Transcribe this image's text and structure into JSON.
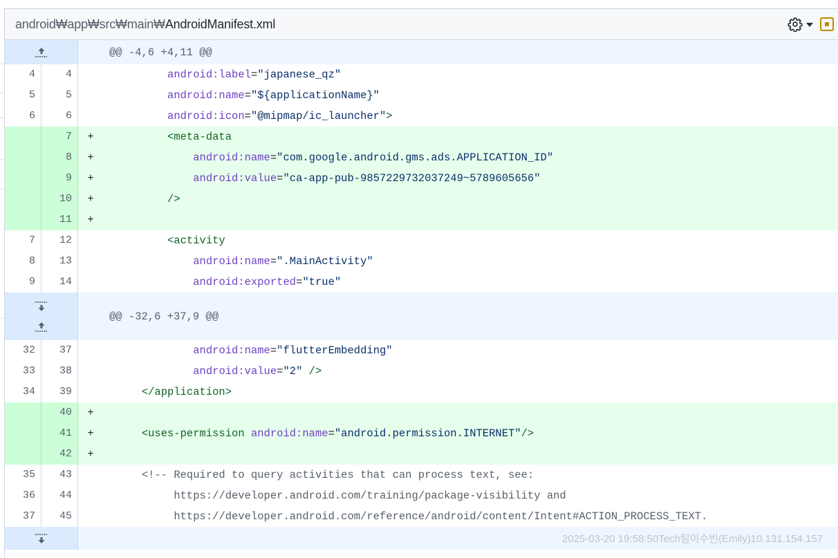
{
  "file": {
    "path_prefix": "android₩app₩src₩main₩",
    "name": "AndroidManifest.xml",
    "icons": {
      "settings": "gear-icon",
      "dropdown": "caret-down-icon",
      "view": "file-view-icon"
    }
  },
  "hunks": [
    {
      "header": "@@ -4,6 +4,11 @@"
    },
    {
      "header": "@@ -32,6 +37,9 @@"
    }
  ],
  "footer": {
    "watermark": "2025-03-20 19:58:50Tech팀이수빈(Emily)10.131.154.157"
  },
  "lines": {
    "l1": {
      "old": "4",
      "new": "4",
      "sign": "",
      "indent": "          ",
      "attr": "android:label",
      "eq": "=",
      "str": "\"japanese_qz\""
    },
    "l2": {
      "old": "5",
      "new": "5",
      "sign": "",
      "indent": "          ",
      "attr": "android:name",
      "eq": "=",
      "str": "\"${applicationName}\""
    },
    "l3": {
      "old": "6",
      "new": "6",
      "sign": "",
      "indent": "          ",
      "attr": "android:icon",
      "eq": "=",
      "str": "\"@mipmap/ic_launcher\"",
      "tag": ">"
    },
    "l4": {
      "old": "",
      "new": "7",
      "sign": "+",
      "indent": "          ",
      "tag": "<meta-data"
    },
    "l5": {
      "old": "",
      "new": "8",
      "sign": "+",
      "indent": "              ",
      "attr": "android:name",
      "eq": "=",
      "str": "\"com.google.android.gms.ads.APPLICATION_ID\""
    },
    "l6": {
      "old": "",
      "new": "9",
      "sign": "+",
      "indent": "              ",
      "attr": "android:value",
      "eq": "=",
      "str": "\"ca-app-pub-9857229732037249~5789605656\""
    },
    "l7": {
      "old": "",
      "new": "10",
      "sign": "+",
      "indent": "          ",
      "tag": "/>"
    },
    "l8": {
      "old": "",
      "new": "11",
      "sign": "+"
    },
    "l9": {
      "old": "7",
      "new": "12",
      "sign": "",
      "indent": "          ",
      "tag": "<activity"
    },
    "l10": {
      "old": "8",
      "new": "13",
      "sign": "",
      "indent": "              ",
      "attr": "android:name",
      "eq": "=",
      "str": "\".MainActivity\""
    },
    "l11": {
      "old": "9",
      "new": "14",
      "sign": "",
      "indent": "              ",
      "attr": "android:exported",
      "eq": "=",
      "str": "\"true\""
    },
    "l12": {
      "old": "32",
      "new": "37",
      "sign": "",
      "indent": "              ",
      "attr": "android:name",
      "eq": "=",
      "str": "\"flutterEmbedding\""
    },
    "l13": {
      "old": "33",
      "new": "38",
      "sign": "",
      "indent": "              ",
      "attr": "android:value",
      "eq": "=",
      "str": "\"2\"",
      "tag": " />"
    },
    "l14": {
      "old": "34",
      "new": "39",
      "sign": "",
      "indent": "      ",
      "tag": "</application>"
    },
    "l15": {
      "old": "",
      "new": "40",
      "sign": "+"
    },
    "l16": {
      "old": "",
      "new": "41",
      "sign": "+",
      "indent": "      ",
      "tag": "<uses-permission",
      "attr": " android:name",
      "eq": "=",
      "str": "\"android.permission.INTERNET\"",
      "tag2": "/>"
    },
    "l17": {
      "old": "",
      "new": "42",
      "sign": "+"
    },
    "l18": {
      "old": "35",
      "new": "43",
      "sign": "",
      "indent": "      ",
      "cmt": "<!-- Required to query activities that can process text, see:"
    },
    "l19": {
      "old": "36",
      "new": "44",
      "sign": "",
      "indent": "           ",
      "cmt": "https://developer.android.com/training/package-visibility and"
    },
    "l20": {
      "old": "37",
      "new": "45",
      "sign": "",
      "indent": "           ",
      "cmt": "https://developer.android.com/reference/android/content/Intent#ACTION_PROCESS_TEXT."
    }
  }
}
